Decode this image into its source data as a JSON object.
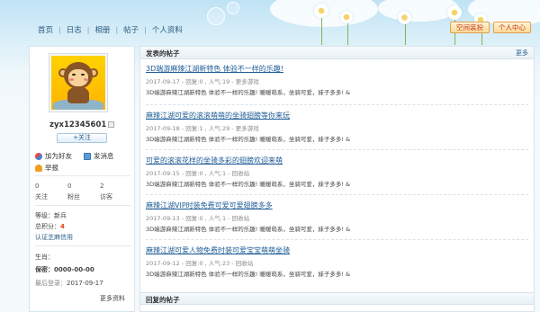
{
  "nav": {
    "items": [
      "首页",
      "日志",
      "相册",
      "帖子",
      "个人资料"
    ]
  },
  "top_buttons": {
    "space_theme": "空间装扮",
    "user_center": "个人中心"
  },
  "profile": {
    "username": "zyx12345601",
    "follow_label": "+关注",
    "actions": {
      "add_friend": "加为好友",
      "send_message": "发消息",
      "report": "举报"
    },
    "stats": [
      {
        "value": "0",
        "label": "关注"
      },
      {
        "value": "0",
        "label": "粉丝"
      },
      {
        "value": "2",
        "label": "访客"
      }
    ],
    "level_label": "等级：",
    "level_value": "新兵",
    "points_label": "总积分：",
    "points_value": "4",
    "cert_link": "认证芝麻信用",
    "zodiac_label": "生肖：",
    "zodiac_value": "",
    "gender_label": "保密：",
    "gender_value": "0000-00-00",
    "last_login_label": "最后登录：",
    "last_login_value": "2017-09-17",
    "more_info": "更多资料"
  },
  "posts_section": {
    "title": "发表的帖子",
    "more": "更多"
  },
  "posts": [
    {
      "title": "3D端游麻辣江湖新特色  体验不一样的乐趣!",
      "meta": "2017-09-17  -  回复:0 ,  人气:19  -  更多游戏",
      "excerpt": "3D端游麻辣江湖新特色  体验不一样的乐趣!      暖暖萌系，坐骑可爱，妹子多多!  &"
    },
    {
      "title": "麻辣江湖可爱的滚滚萌萌的坐骑翅膀等你来玩",
      "meta": "2017-09-18  -  回复:1 ,  人气:29  -  更多游戏",
      "excerpt": "3D端游麻辣江湖新特色  体验不一样的乐趣!      暖暖萌系，坐骑可爱，妹子多多!  &"
    },
    {
      "title": "可爱的滚滚花样的坐骑多彩的翅膀欢迎来萌",
      "meta": "2017-09-15  -  回复:0 ,  人气:1  -  回收站",
      "excerpt": "3D端游麻辣江湖新特色  体验不一样的乐趣!      暖暖萌系，坐骑可爱，妹子多多!  &"
    },
    {
      "title": "麻辣江湖VIP时装免费可爱可爱翅膀多多",
      "meta": "2017-09-13  -  回复:0 ,  人气:1  -  回收站",
      "excerpt": "3D端游麻辣江湖新特色  体验不一样的乐趣!      暖暖萌系，坐骑可爱，妹子多多!  &"
    },
    {
      "title": "麻辣江湖可爱人物免费时装可爱宝宝萌萌坐骑",
      "meta": "2017-09-12  -  回复:0 ,  人气:23  -  回收站",
      "excerpt": "3D端游麻辣江湖新特色  体验不一样的乐趣!      暖暖萌系，坐骑可爱，妹子多多!  &"
    }
  ],
  "replies_section": {
    "title": "回复的帖子"
  },
  "colors": {
    "link": "#1d5c96",
    "accent_red": "#e0400a",
    "panel_border": "#d8e4ec"
  },
  "icons": {
    "add_friend": "add-friend-icon",
    "message": "message-icon",
    "report": "warning-icon"
  }
}
